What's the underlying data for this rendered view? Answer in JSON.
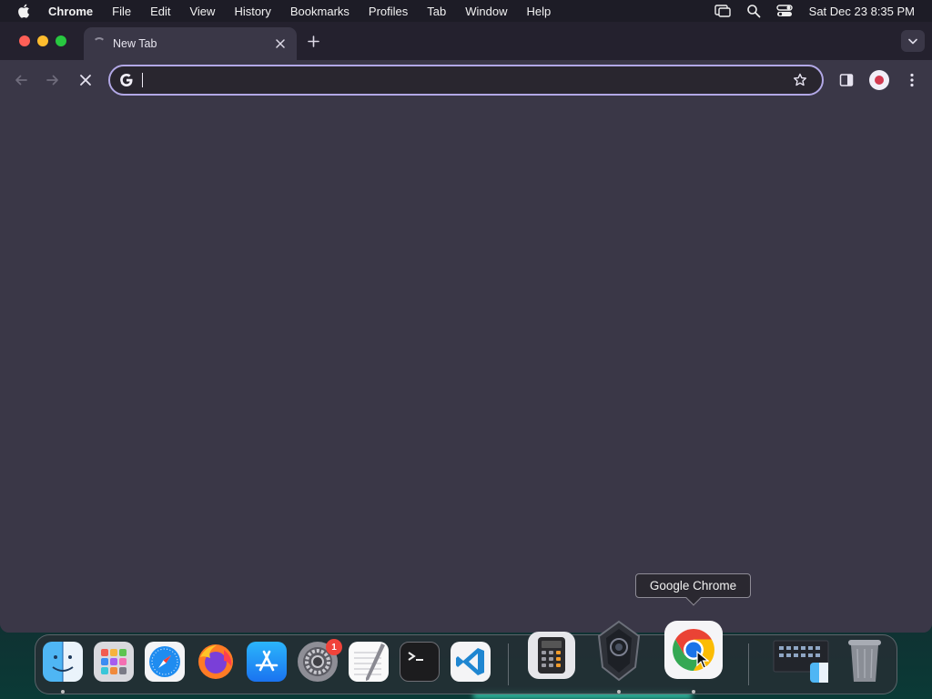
{
  "menubar": {
    "app_name": "Chrome",
    "items": [
      "File",
      "Edit",
      "View",
      "History",
      "Bookmarks",
      "Profiles",
      "Tab",
      "Window",
      "Help"
    ],
    "clock": "Sat Dec 23  8:35 PM"
  },
  "browser": {
    "tab": {
      "title": "New Tab",
      "loading": true
    },
    "omnibox": {
      "value": "",
      "placeholder": ""
    }
  },
  "tooltip": {
    "text": "Google Chrome"
  },
  "dock": {
    "apps": [
      {
        "name": "Finder",
        "icon": "finder-icon",
        "running": true
      },
      {
        "name": "Launchpad",
        "icon": "launchpad-icon",
        "running": false
      },
      {
        "name": "Safari",
        "icon": "safari-icon",
        "running": false
      },
      {
        "name": "Firefox",
        "icon": "firefox-icon",
        "running": false
      },
      {
        "name": "App Store",
        "icon": "app-store-icon",
        "running": false
      },
      {
        "name": "System Settings",
        "icon": "system-settings-icon",
        "running": false,
        "badge": "1"
      },
      {
        "name": "TextEdit",
        "icon": "textedit-icon",
        "running": false
      },
      {
        "name": "Terminal",
        "icon": "terminal-icon",
        "running": false
      },
      {
        "name": "Visual Studio Code",
        "icon": "vscode-icon",
        "running": false
      },
      {
        "name": "Calculator",
        "icon": "calculator-icon",
        "running": false
      },
      {
        "name": "Shield App",
        "icon": "shield-app-icon",
        "running": true
      },
      {
        "name": "Google Chrome",
        "icon": "chrome-icon",
        "running": true
      },
      {
        "name": "Downloads",
        "icon": "downloads-stack-icon",
        "running": false
      },
      {
        "name": "Trash",
        "icon": "trash-icon",
        "running": false
      }
    ]
  },
  "colors": {
    "menubar_bg": "#1d1c26",
    "titlebar_bg": "#24212e",
    "window_bg": "#3a3747",
    "omnibox_border": "#b2a8e6",
    "traffic_close": "#fe5f57",
    "traffic_min": "#febc2e",
    "traffic_max": "#28c840"
  }
}
